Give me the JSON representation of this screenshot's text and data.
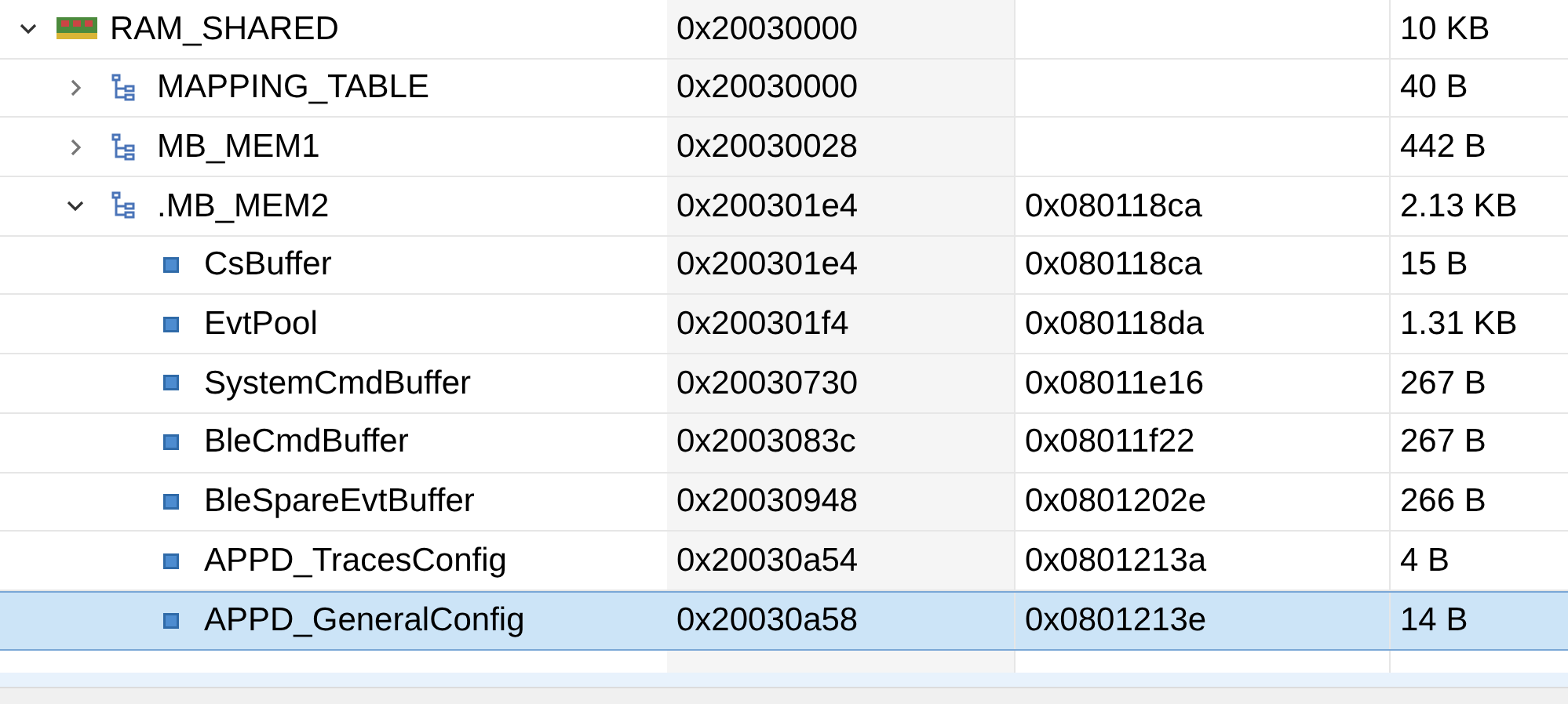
{
  "rows": [
    {
      "kind": "region",
      "name": "RAM_SHARED",
      "address": "0x20030000",
      "size": "10 KB",
      "expanded": true,
      "selected": false,
      "children": [
        {
          "kind": "section",
          "name": "MAPPING_TABLE",
          "address": "0x20030000",
          "size": "40 B",
          "expanded": false,
          "selected": false
        },
        {
          "kind": "section",
          "name": "MB_MEM1",
          "address": "0x20030028",
          "size": "442 B",
          "expanded": false,
          "selected": false
        },
        {
          "kind": "section",
          "name": ".MB_MEM2",
          "address": "0x200301e4",
          "load_address": "0x080118ca",
          "size": "2.13 KB",
          "expanded": true,
          "selected": false,
          "children": [
            {
              "kind": "symbol",
              "name": "CsBuffer",
              "address": "0x200301e4",
              "load_address": "0x080118ca",
              "size": "15 B",
              "selected": false
            },
            {
              "kind": "symbol",
              "name": "EvtPool",
              "address": "0x200301f4",
              "load_address": "0x080118da",
              "size": "1.31 KB",
              "selected": false
            },
            {
              "kind": "symbol",
              "name": "SystemCmdBuffer",
              "address": "0x20030730",
              "load_address": "0x08011e16",
              "size": "267 B",
              "selected": false
            },
            {
              "kind": "symbol",
              "name": "BleCmdBuffer",
              "address": "0x2003083c",
              "load_address": "0x08011f22",
              "size": "267 B",
              "selected": false
            },
            {
              "kind": "symbol",
              "name": "BleSpareEvtBuffer",
              "address": "0x20030948",
              "load_address": "0x0801202e",
              "size": "266 B",
              "selected": false
            },
            {
              "kind": "symbol",
              "name": "APPD_TracesConfig",
              "address": "0x20030a54",
              "load_address": "0x0801213a",
              "size": "4 B",
              "selected": false
            },
            {
              "kind": "symbol",
              "name": "APPD_GeneralConfig",
              "address": "0x20030a58",
              "load_address": "0x0801213e",
              "size": "14 B",
              "selected": true
            }
          ]
        }
      ]
    }
  ]
}
